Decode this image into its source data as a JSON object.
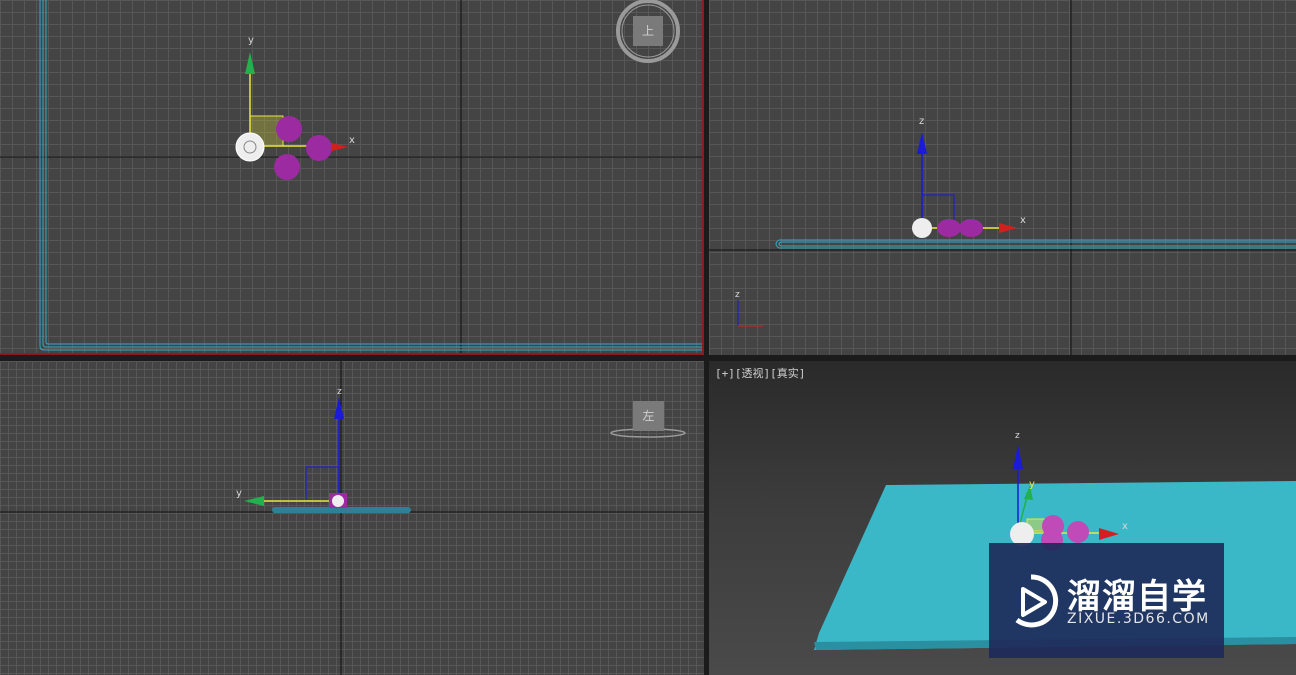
{
  "viewports": {
    "top": {
      "viewcube_label": "上",
      "axis_x": "x",
      "axis_y": "y"
    },
    "front": {
      "axis_x": "x",
      "axis_z": "z",
      "mini_axis_z": "z"
    },
    "left": {
      "viewcube_label": "左",
      "axis_y": "y",
      "axis_z": "z"
    },
    "perspective": {
      "label_plus": "[+]",
      "label_view": "[透视]",
      "label_shading": "[真实]",
      "axis_x": "x",
      "axis_y": "y",
      "axis_z": "z"
    }
  },
  "watermark": {
    "title": "溜溜自学",
    "url": "ZIXUE.3D66.COM",
    "icon": "play-logo-icon"
  },
  "colors": {
    "viewport_bg": "#444444",
    "grid_line": "#575757",
    "active_border": "#8c1d1d",
    "plane_outline": "#3aa9c4",
    "plane_fill": "#3bb8c8",
    "gizmo_x": "#d41f1f",
    "gizmo_y": "#22b14c",
    "gizmo_z": "#1a1ad8",
    "gizmo_plane": "#e8e83a",
    "sphere_magenta": "#9c2aa0",
    "watermark_bg": "#1e2a5a"
  }
}
